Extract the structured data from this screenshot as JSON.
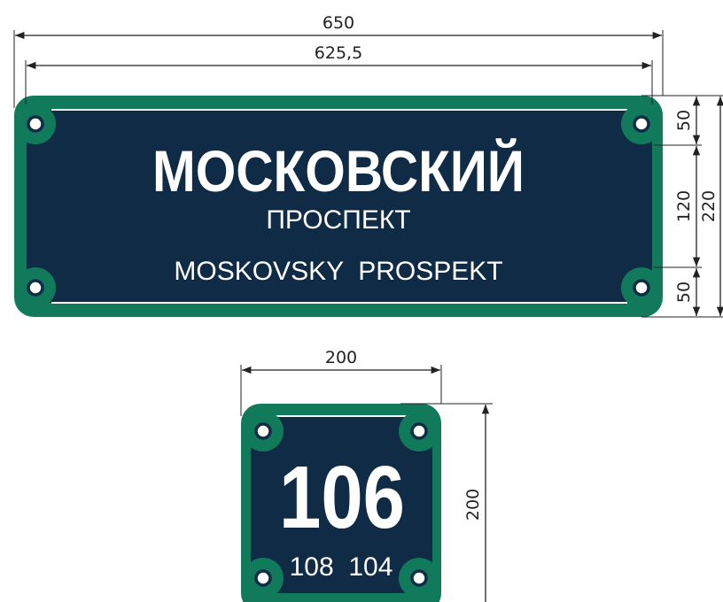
{
  "colors": {
    "plate": "#0f2b45",
    "frame": "#117a5b",
    "text": "#ffffff",
    "line": "#222222"
  },
  "street_sign": {
    "name": "МОСКОВСКИЙ",
    "type": "ПРОСПЕКТ",
    "latin": "MOSKOVSKY  PROSPEKT",
    "dimensions": {
      "total_width": "650",
      "inner_width": "625,5",
      "top_band": "50",
      "middle_band": "120",
      "bottom_band": "50",
      "total_height": "220"
    }
  },
  "house_sign": {
    "number": "106",
    "neighbors": "108  104",
    "dimensions": {
      "width": "200",
      "height": "200"
    }
  }
}
